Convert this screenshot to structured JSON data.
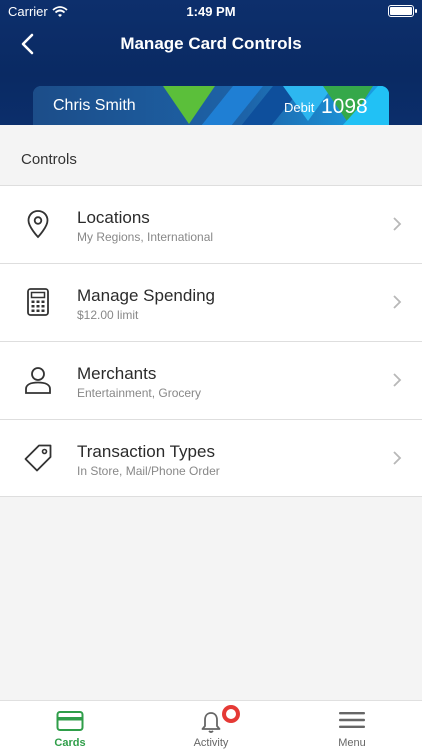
{
  "status_bar": {
    "carrier": "Carrier",
    "time": "1:49 PM"
  },
  "nav": {
    "title": "Manage Card Controls",
    "back_icon": "chevron-left-icon"
  },
  "card": {
    "holder": "Chris Smith",
    "type": "Debit",
    "last4": "1098"
  },
  "controls": {
    "section_title": "Controls",
    "items": [
      {
        "label": "Locations",
        "sub": "My Regions, International",
        "icon": "location-pin-icon"
      },
      {
        "label": "Manage Spending",
        "sub": "$12.00 limit",
        "icon": "calculator-icon"
      },
      {
        "label": "Merchants",
        "sub": "Entertainment, Grocery",
        "icon": "person-icon"
      },
      {
        "label": "Transaction Types",
        "sub": "In Store, Mail/Phone Order",
        "icon": "tag-icon"
      }
    ]
  },
  "tabs": [
    {
      "label": "Cards",
      "icon": "card-icon",
      "active": true
    },
    {
      "label": "Activity",
      "icon": "bell-icon",
      "active": false
    },
    {
      "label": "Menu",
      "icon": "hamburger-icon",
      "active": false
    }
  ],
  "colors": {
    "header": "#0a2a63",
    "active_tab": "#2f9e49",
    "badge": "#e53935"
  }
}
